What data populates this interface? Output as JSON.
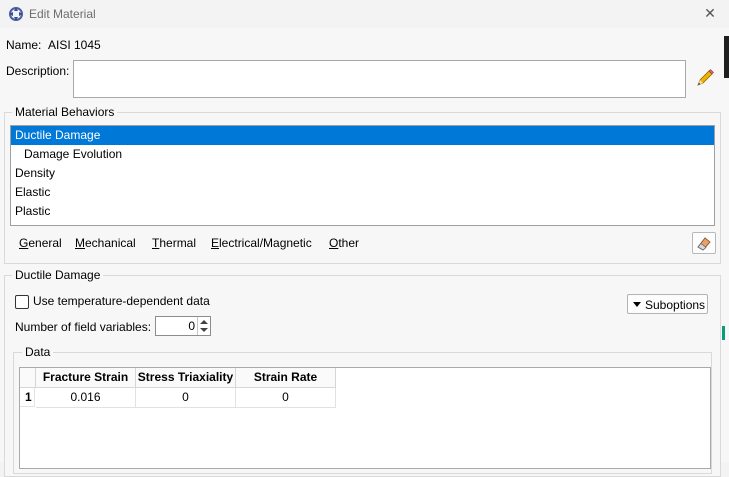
{
  "window": {
    "title": "Edit Material",
    "close_glyph": "✕"
  },
  "name": {
    "label": "Name:",
    "value": "AISI 1045"
  },
  "description": {
    "label": "Description:",
    "value": ""
  },
  "material_behaviors": {
    "legend": "Material Behaviors",
    "items": [
      {
        "label": "Ductile Damage",
        "selected": true,
        "indent": false
      },
      {
        "label": "Damage Evolution",
        "selected": false,
        "indent": true
      },
      {
        "label": "Density",
        "selected": false,
        "indent": false
      },
      {
        "label": "Elastic",
        "selected": false,
        "indent": false
      },
      {
        "label": "Plastic",
        "selected": false,
        "indent": false
      }
    ]
  },
  "menu": {
    "items": [
      {
        "first": "G",
        "rest": "eneral"
      },
      {
        "first": "M",
        "rest": "echanical"
      },
      {
        "first": "T",
        "rest": "hermal"
      },
      {
        "first": "E",
        "rest": "lectrical/Magnetic"
      },
      {
        "first": "O",
        "rest": "ther"
      }
    ]
  },
  "ductile_damage": {
    "legend": "Ductile Damage",
    "temp_dependent_label": "Use temperature-dependent data",
    "temp_dependent_checked": false,
    "suboptions_label": "Suboptions",
    "field_vars_label": "Number of field variables:",
    "field_vars_value": "0"
  },
  "data_table": {
    "legend": "Data",
    "columns": [
      "Fracture Strain",
      "Stress Triaxiality",
      "Strain Rate"
    ],
    "rows": [
      {
        "index": "1",
        "cells": [
          "0.016",
          "0",
          "0"
        ]
      }
    ]
  },
  "colors": {
    "selection": "#0078d7",
    "accent": "#0b9a7a"
  },
  "icons": [
    "app-icon",
    "close-icon",
    "pencil-icon",
    "eraser-icon",
    "dropdown-arrow-icon",
    "spinner-icon"
  ]
}
